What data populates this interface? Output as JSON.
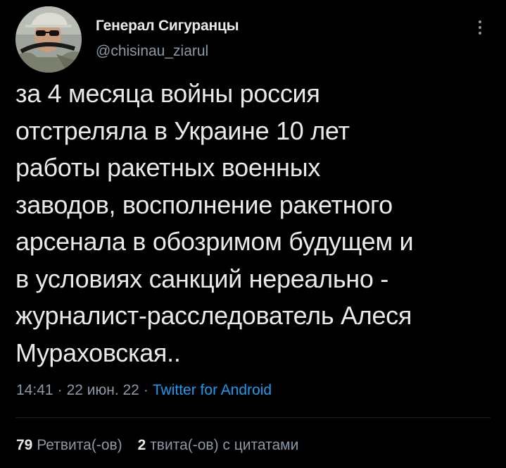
{
  "tweet": {
    "author": {
      "display_name": "Генерал Сигуранцы",
      "handle": "@chisinau_ziarul"
    },
    "text": "за 4 месяца войны россия\nотстреляла в Украине 10 лет\nработы ракетных военных\nзаводов, восполнение ракетного\nарсенала в обозримом будущем и\nв условиях санкций нереально -\nжурналист-расследователь Алеся\nМураховская..",
    "time": "14:41",
    "separator": "·",
    "date": "22 июн. 22",
    "source": "Twitter for Android",
    "retweets_count": "79",
    "retweets_label": "Ретвита(-ов)",
    "quotes_count": "2",
    "quotes_label": "твита(-ов) с цитатами"
  },
  "colors": {
    "background": "#000000",
    "primary_text": "#e7e9ea",
    "secondary_text": "#8b98a5",
    "link": "#1d9bf0"
  },
  "icons": {
    "more": "more-vertical-icon"
  }
}
